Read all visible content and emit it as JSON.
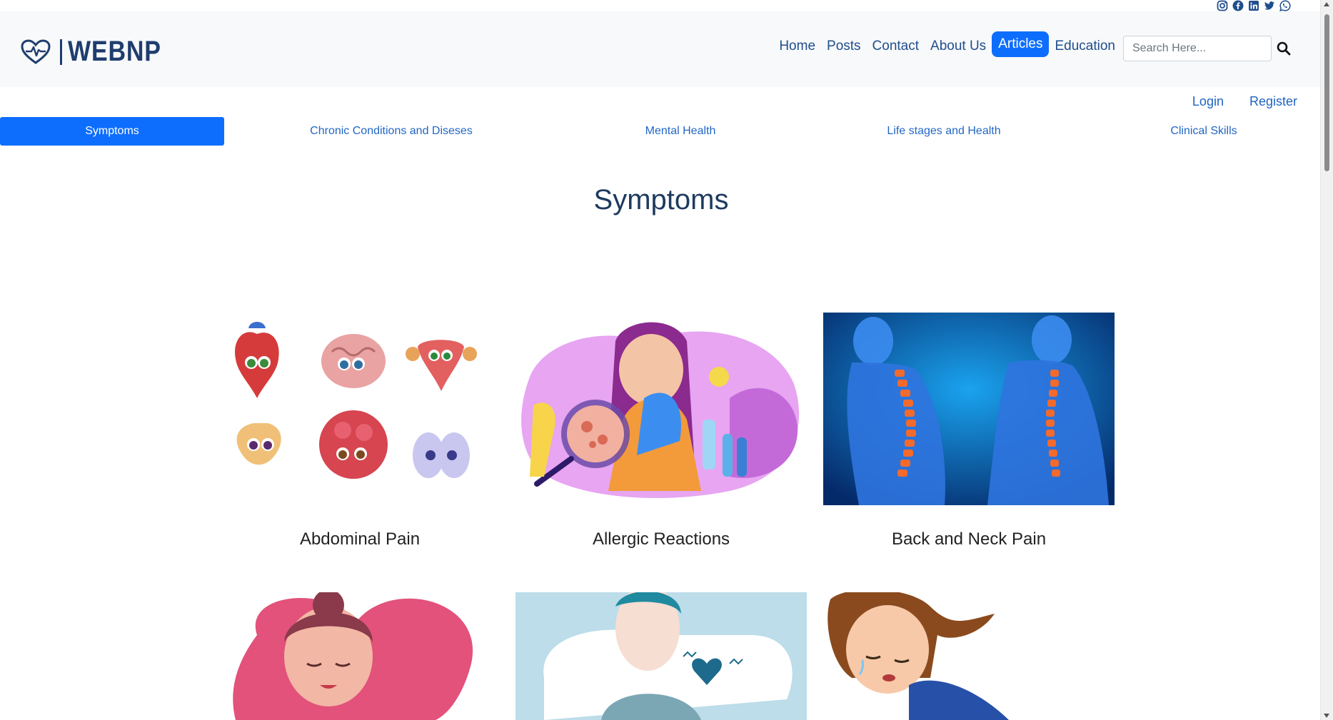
{
  "social": {
    "icons": [
      "instagram-icon",
      "facebook-icon",
      "linkedin-icon",
      "twitter-icon",
      "whatsapp-icon"
    ]
  },
  "header": {
    "logo_text": "WEBNP",
    "nav": [
      {
        "label": "Home"
      },
      {
        "label": "Posts"
      },
      {
        "label": "Contact"
      },
      {
        "label": "About Us"
      },
      {
        "label": "Articles",
        "active": true
      },
      {
        "label": "Education"
      }
    ],
    "search_placeholder": "Search Here..."
  },
  "auth": {
    "login": "Login",
    "register": "Register"
  },
  "tabs": [
    {
      "label": "Symptoms",
      "active": true
    },
    {
      "label": "Chronic Conditions and Diseses"
    },
    {
      "label": "Mental Health"
    },
    {
      "label": "Life stages and Health"
    },
    {
      "label": "Clinical Skills"
    }
  ],
  "page_title": "Symptoms",
  "cards": [
    {
      "title": "Abdominal Pain"
    },
    {
      "title": "Allergic Reactions"
    },
    {
      "title": "Back and Neck Pain"
    },
    {
      "title": ""
    },
    {
      "title": ""
    },
    {
      "title": ""
    }
  ],
  "colors": {
    "accent": "#0d6efd",
    "nav_text": "#1f4e8c",
    "brand": "#1f3d6e",
    "title": "#1e3a5f"
  }
}
